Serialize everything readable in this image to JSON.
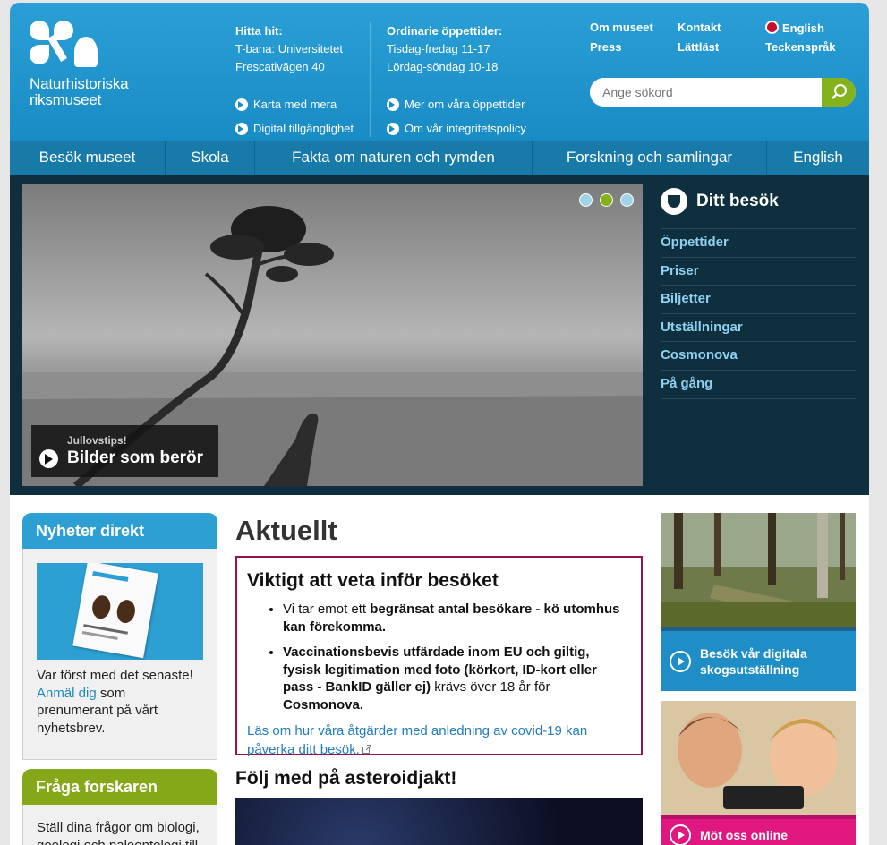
{
  "brand": {
    "line1": "Naturhistoriska",
    "line2": "riksmuseet"
  },
  "header": {
    "find": {
      "title": "Hitta hit:",
      "line1": "T-bana: Universitetet",
      "line2": "Frescativägen 40",
      "link1": "Karta med mera",
      "link2": "Digital tillgänglighet"
    },
    "hours": {
      "title": "Ordinarie öppettider:",
      "line1": "Tisdag-fredag 11-17",
      "line2": "Lördag-söndag 10-18",
      "link1": "Mer om våra öppettider",
      "link2": "Om vår integritetspolicy"
    },
    "toplinks": {
      "about": "Om museet",
      "contact": "Kontakt",
      "english": "English",
      "press": "Press",
      "easy": "Lättläst",
      "sign": "Teckenspråk"
    },
    "search": {
      "placeholder": "Ange sökord"
    }
  },
  "nav": [
    "Besök museet",
    "Skola",
    "Fakta om naturen och rymden",
    "Forskning och samlingar",
    "English"
  ],
  "hero": {
    "kicker": "Jullovstips!",
    "title": "Bilder som berör",
    "dots": 3,
    "active_dot": 2
  },
  "visit": {
    "title": "Ditt besök",
    "links": [
      "Öppettider",
      "Priser",
      "Biljetter",
      "Utställningar",
      "Cosmonova",
      "På gång"
    ]
  },
  "news": {
    "title": "Nyheter direkt",
    "text1": "Var först med det senaste!",
    "link": "Anmäl dig",
    "text2": "som prenumerant på vårt nyhetsbrev."
  },
  "ask": {
    "title": "Fråga forskaren",
    "text": "Ställ dina frågor om biologi, geologi och paleontologi till"
  },
  "main": {
    "heading": "Aktuellt",
    "notice": {
      "title": "Viktigt att veta inför besöket",
      "item1_bold": "Vi tar emot ett begränsat antal besökare - kö utomhus kan förekomma.",
      "item1_prefix": "Vi tar emot ett ",
      "item2_bold": "Vaccinationsbevis utfärdade inom EU och giltig, fysisk legitimation med foto (körkort, ID-kort eller pass - BankID gäller ej)",
      "item2_mid": " krävs över 18 år för ",
      "item2_end": "Cosmonova.",
      "link": "Läs om hur våra åtgärder med anledning av covid-19 kan påverka ditt besök."
    },
    "asteroid": "Följ med på asteroidjakt!"
  },
  "promos": [
    {
      "label": "Besök vår digitala skogsutställning",
      "color": "#1f8ec6"
    },
    {
      "label": "Möt oss online",
      "color": "#e0177e"
    }
  ]
}
